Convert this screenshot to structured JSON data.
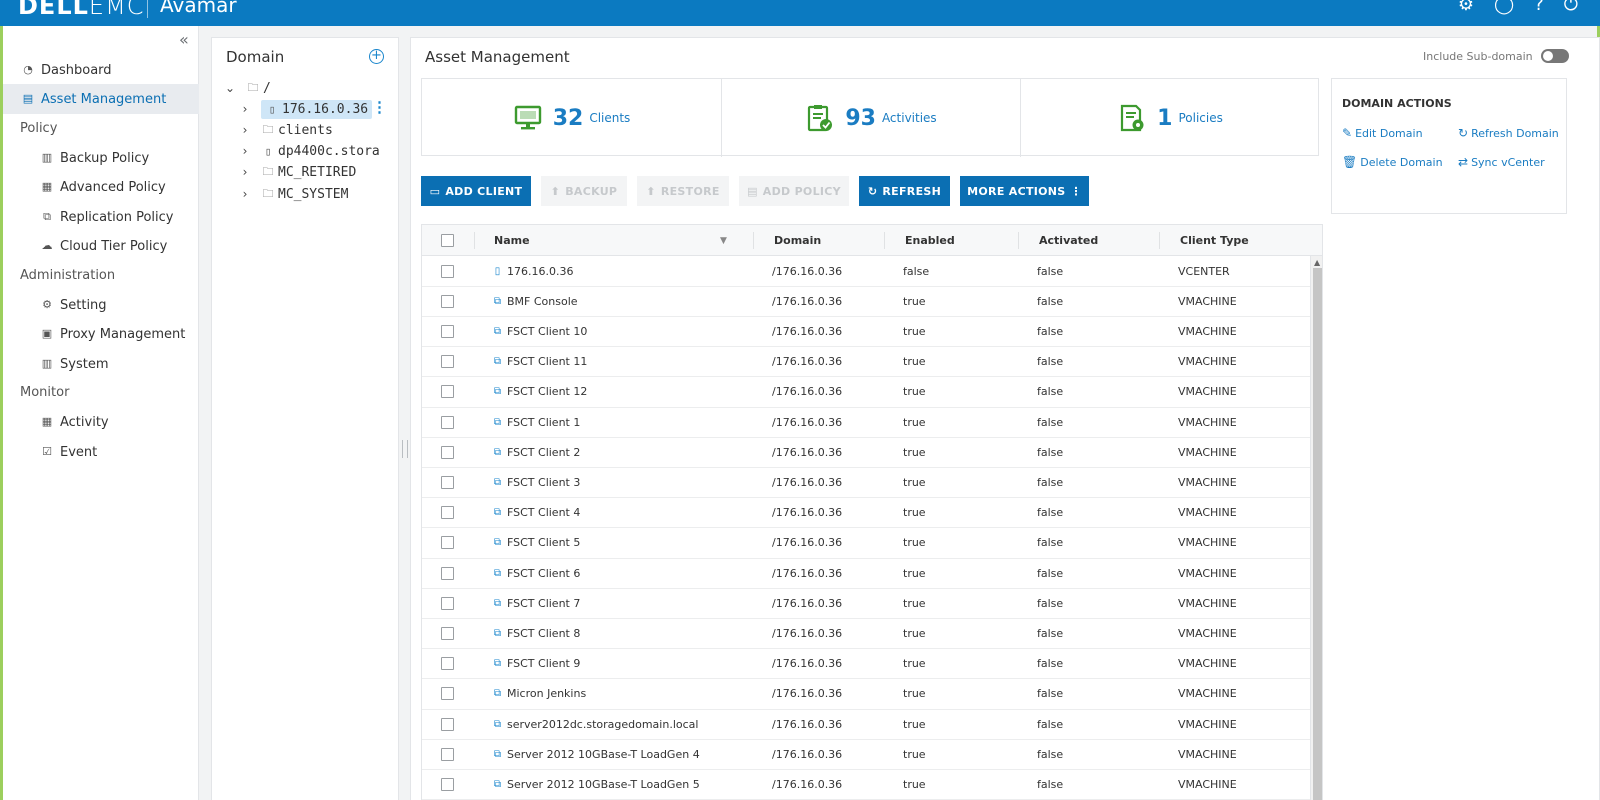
{
  "header": {
    "brand_left": "DELL",
    "brand_right": "EMC",
    "app_name": "Avamar",
    "icons": [
      "gear-icon",
      "user-icon",
      "help-icon",
      "power-icon"
    ]
  },
  "nav": {
    "collapse_icon": "double-chevron-left-icon",
    "dashboard": "Dashboard",
    "asset_management": "Asset Management",
    "section_policy": "Policy",
    "backup_policy": "Backup Policy",
    "advanced_policy": "Advanced Policy",
    "replication_policy": "Replication Policy",
    "cloud_tier_policy": "Cloud Tier Policy",
    "section_administration": "Administration",
    "setting": "Setting",
    "proxy_management": "Proxy Management",
    "system": "System",
    "section_monitor": "Monitor",
    "activity": "Activity",
    "event": "Event"
  },
  "domain_panel": {
    "title": "Domain",
    "root": "/",
    "nodes": [
      {
        "label": "176.16.0.36",
        "selected": true
      },
      {
        "label": "clients",
        "selected": false
      },
      {
        "label": "dp4400c.stora",
        "selected": false
      },
      {
        "label": "MC_RETIRED",
        "selected": false
      },
      {
        "label": "MC_SYSTEM",
        "selected": false
      }
    ]
  },
  "main": {
    "title": "Asset Management",
    "include_subdomain": "Include Sub-domain",
    "include_subdomain_on": false
  },
  "stats": [
    {
      "value": "32",
      "label": "Clients",
      "icon": "monitor-icon"
    },
    {
      "value": "93",
      "label": "Activities",
      "icon": "clipboard-check-icon"
    },
    {
      "value": "1",
      "label": "Policies",
      "icon": "policy-gear-icon"
    }
  ],
  "domain_actions": {
    "title": "DOMAIN ACTIONS",
    "edit": "Edit Domain",
    "refresh": "Refresh Domain",
    "delete": "Delete Domain",
    "sync": "Sync vCenter"
  },
  "toolbar": {
    "add_client": "ADD CLIENT",
    "backup": "BACKUP",
    "restore": "RESTORE",
    "add_policy": "ADD POLICY",
    "refresh": "REFRESH",
    "more_actions": "MORE ACTIONS"
  },
  "table": {
    "columns": [
      "Name",
      "Domain",
      "Enabled",
      "Activated",
      "Client Type"
    ],
    "rows": [
      {
        "name": "176.16.0.36",
        "domain": "/176.16.0.36",
        "enabled": "false",
        "activated": "false",
        "type": "VCENTER",
        "icon": "server-icon"
      },
      {
        "name": "BMF Console",
        "domain": "/176.16.0.36",
        "enabled": "true",
        "activated": "false",
        "type": "VMACHINE",
        "icon": "vm-icon"
      },
      {
        "name": "FSCT Client 10",
        "domain": "/176.16.0.36",
        "enabled": "true",
        "activated": "false",
        "type": "VMACHINE",
        "icon": "vm-icon"
      },
      {
        "name": "FSCT Client 11",
        "domain": "/176.16.0.36",
        "enabled": "true",
        "activated": "false",
        "type": "VMACHINE",
        "icon": "vm-icon"
      },
      {
        "name": "FSCT Client 12",
        "domain": "/176.16.0.36",
        "enabled": "true",
        "activated": "false",
        "type": "VMACHINE",
        "icon": "vm-icon"
      },
      {
        "name": "FSCT Client 1",
        "domain": "/176.16.0.36",
        "enabled": "true",
        "activated": "false",
        "type": "VMACHINE",
        "icon": "vm-icon"
      },
      {
        "name": "FSCT Client 2",
        "domain": "/176.16.0.36",
        "enabled": "true",
        "activated": "false",
        "type": "VMACHINE",
        "icon": "vm-icon"
      },
      {
        "name": "FSCT Client 3",
        "domain": "/176.16.0.36",
        "enabled": "true",
        "activated": "false",
        "type": "VMACHINE",
        "icon": "vm-icon"
      },
      {
        "name": "FSCT Client 4",
        "domain": "/176.16.0.36",
        "enabled": "true",
        "activated": "false",
        "type": "VMACHINE",
        "icon": "vm-icon"
      },
      {
        "name": "FSCT Client 5",
        "domain": "/176.16.0.36",
        "enabled": "true",
        "activated": "false",
        "type": "VMACHINE",
        "icon": "vm-icon"
      },
      {
        "name": "FSCT Client 6",
        "domain": "/176.16.0.36",
        "enabled": "true",
        "activated": "false",
        "type": "VMACHINE",
        "icon": "vm-icon"
      },
      {
        "name": "FSCT Client 7",
        "domain": "/176.16.0.36",
        "enabled": "true",
        "activated": "false",
        "type": "VMACHINE",
        "icon": "vm-icon"
      },
      {
        "name": "FSCT Client 8",
        "domain": "/176.16.0.36",
        "enabled": "true",
        "activated": "false",
        "type": "VMACHINE",
        "icon": "vm-icon"
      },
      {
        "name": "FSCT Client 9",
        "domain": "/176.16.0.36",
        "enabled": "true",
        "activated": "false",
        "type": "VMACHINE",
        "icon": "vm-icon"
      },
      {
        "name": "Micron Jenkins",
        "domain": "/176.16.0.36",
        "enabled": "true",
        "activated": "false",
        "type": "VMACHINE",
        "icon": "vm-icon"
      },
      {
        "name": "server2012dc.storagedomain.local",
        "domain": "/176.16.0.36",
        "enabled": "true",
        "activated": "false",
        "type": "VMACHINE",
        "icon": "vm-icon"
      },
      {
        "name": "Server 2012 10GBase-T LoadGen 4",
        "domain": "/176.16.0.36",
        "enabled": "true",
        "activated": "false",
        "type": "VMACHINE",
        "icon": "vm-icon"
      },
      {
        "name": "Server 2012 10GBase-T LoadGen 5",
        "domain": "/176.16.0.36",
        "enabled": "true",
        "activated": "false",
        "type": "VMACHINE",
        "icon": "vm-icon"
      }
    ]
  },
  "colors": {
    "header_blue": "#0b7ac1",
    "primary_button": "#0b6fb3",
    "link_blue": "#1a7cc2",
    "stat_icon_green": "#3d9a2f",
    "window_frame_green": "#9ccf5d"
  }
}
